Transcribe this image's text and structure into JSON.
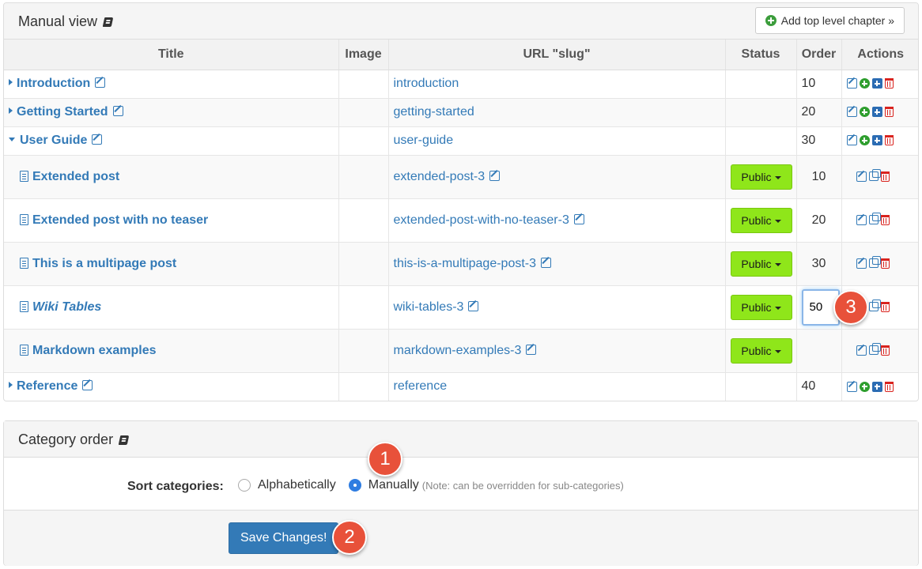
{
  "manual_panel": {
    "title": "Manual view",
    "add_button_label": "Add top level chapter »",
    "columns": [
      "Title",
      "Image",
      "URL \"slug\"",
      "Status",
      "Order",
      "Actions"
    ]
  },
  "rows": [
    {
      "title": "Introduction",
      "slug": "introduction",
      "order": "10"
    },
    {
      "title": "Getting Started",
      "slug": "getting-started",
      "order": "20"
    },
    {
      "title": "User Guide",
      "slug": "user-guide",
      "order": "30"
    },
    {
      "title": "Extended post",
      "slug": "extended-post-3",
      "status": "Public",
      "order": "10"
    },
    {
      "title": "Extended post with no teaser",
      "slug": "extended-post-with-no-teaser-3",
      "status": "Public",
      "order": "20"
    },
    {
      "title": "This is a multipage post",
      "slug": "this-is-a-multipage-post-3",
      "status": "Public",
      "order": "30"
    },
    {
      "title": "Wiki Tables",
      "slug": "wiki-tables-3",
      "status": "Public",
      "order": "50"
    },
    {
      "title": "Markdown examples",
      "slug": "markdown-examples-3",
      "status": "Public",
      "order": ""
    },
    {
      "title": "Reference",
      "slug": "reference",
      "order": "40"
    }
  ],
  "category_panel": {
    "title": "Category order",
    "sort_label": "Sort categories:",
    "option_alpha": "Alphabetically",
    "option_manual": "Manually",
    "note": "(Note: can be overridden for sub-categories)",
    "save_label": "Save Changes!"
  },
  "callouts": {
    "one": "1",
    "two": "2",
    "three": "3"
  },
  "colors": {
    "accent": "#337ab7",
    "status_green": "#8fe61a",
    "callout": "#e8513a",
    "delete_red": "#d9231e"
  }
}
